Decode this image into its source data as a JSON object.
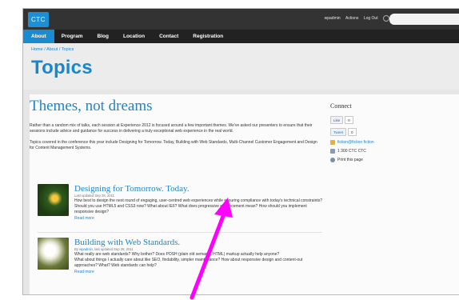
{
  "topbar": {
    "logo": "CTC",
    "user": "wpadmin",
    "actions": "Actions",
    "logout": "Log Out",
    "search_placeholder": ""
  },
  "nav": {
    "items": [
      {
        "label": "About"
      },
      {
        "label": "Program"
      },
      {
        "label": "Blog"
      },
      {
        "label": "Location"
      },
      {
        "label": "Contact"
      },
      {
        "label": "Registration"
      }
    ]
  },
  "header": {
    "breadcrumb": "Home / About / Topics",
    "title": "Topics"
  },
  "main": {
    "title": "Themes, not dreams",
    "intro_p1": "Rather than a random mix of talks, each session at Experience 2012 is focused around a few important themes. We've asked our presenters to ensure that their sessions include advice and guidance for success in delivering a truly exceptional web experience in the real world.",
    "intro_p2": "Topics covered in the conference this year include Designing for Tomorrow. Today, Building with Web Standards, Multi-Channel Customer Engagement and Design for Content Management Systems.",
    "posts": [
      {
        "title": "Designing for Tomorrow. Today.",
        "meta": "Last updated Sep 28, 2011",
        "text1": "How best to design the next round of engaging, user-centred web experiences while ensuring compliance with today's technical constraints?",
        "text2": "Should you use HTML5 and CSS3 now? What about IE6? What does progressive enhancement mean? How should you implement responsive design?",
        "read_more": "Read more"
      },
      {
        "title": "Building with Web Standards.",
        "meta_prefix": "By",
        "author": "wpadmin",
        "meta_suffix": ", last updated Sep 28, 2011",
        "text1": "What really are web standards? Why bother? Does POSH (plain old semantic HTML) markup actually help anyone?",
        "text2": "What about things I actually care about like SEO, findability, simpler maintenance? How about responsive design and content-out approaches? What? Web standards can help?",
        "read_more": "Read more"
      }
    ]
  },
  "sidebar": {
    "title": "Connect",
    "like_label": "Like",
    "like_count": "0",
    "tweet_label": "Tweet",
    "tweet_count": "0",
    "facebook": "fiction@fiction fiction",
    "phone": "1 300 CTC CTC",
    "print": "Print this page"
  },
  "colors": {
    "accent": "#1a8bd1",
    "annotation_arrow": "#ff00ff"
  }
}
